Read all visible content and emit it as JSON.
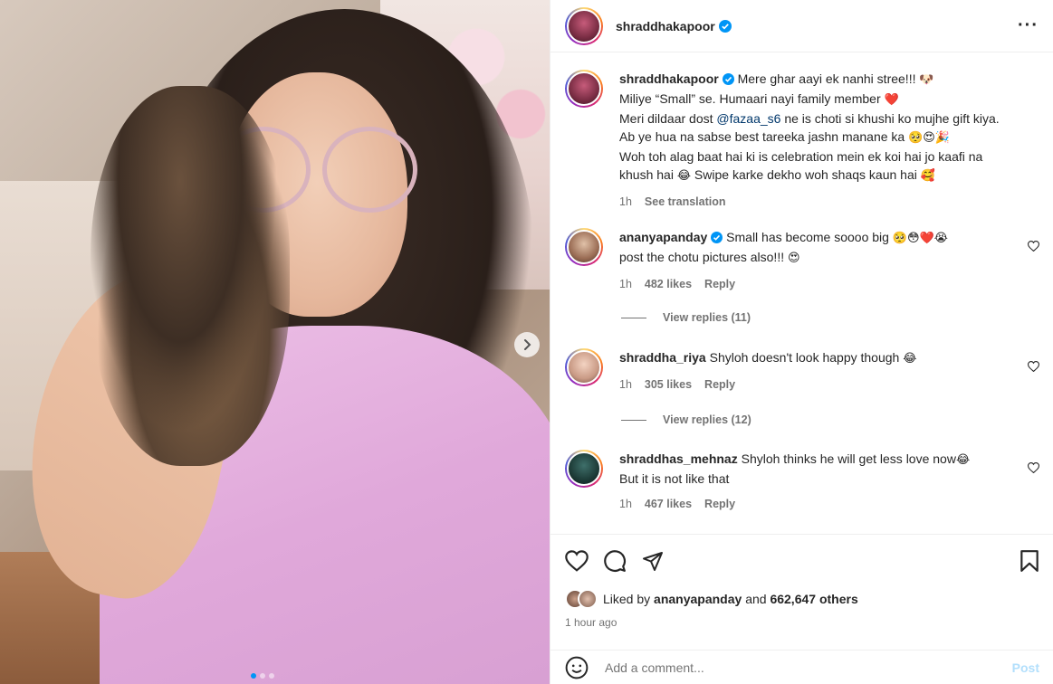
{
  "post": {
    "username": "shraddhakapoor",
    "verified": true,
    "slides": 3,
    "active_slide": 1
  },
  "caption": {
    "username": "shraddhakapoor",
    "part1": " Mere ghar aayi ek nanhi stree!!! ",
    "emoji1": "🐶",
    "line2": "Miliye “Small” se. Humaari nayi family member ",
    "emoji2": "❤️",
    "line3a": "Meri dildaar dost ",
    "mention": "@fazaa_s6",
    "line3b": " ne is choti si khushi ko mujhe gift kiya. Ab ye hua na sabse best tareeka jashn manane ka ",
    "emoji3": "🥺😍🎉",
    "line4": "Woh toh alag baat hai ki is celebration mein ek koi hai jo kaafi na khush hai ",
    "emoji4": "😂",
    "line5": " Swipe karke dekho woh shaqs kaun hai ",
    "emoji5": "🥰",
    "time": "1h",
    "translate": "See translation"
  },
  "comments": [
    {
      "username": "ananyapanday",
      "verified": true,
      "text": " Small has become soooo big ",
      "emoji": "🥺😳❤️😭",
      "text2": "post the chotu pictures also!!! ",
      "emoji2": "😍",
      "time": "1h",
      "likes": "482 likes",
      "reply": "Reply",
      "view_replies": "View replies (11)"
    },
    {
      "username": "shraddha_riya",
      "text": " Shyloh doesn't look happy though ",
      "emoji": "😂",
      "time": "1h",
      "likes": "305 likes",
      "reply": "Reply",
      "view_replies": "View replies (12)"
    },
    {
      "username": "shraddhas_mehnaz",
      "text": " Shyloh thinks he will get less love now",
      "emoji": "😂",
      "text2": "But it is not like that",
      "time": "1h",
      "likes": "467 likes",
      "reply": "Reply"
    }
  ],
  "likes": {
    "prefix": "Liked by ",
    "user": "ananyapanday",
    "middle": " and ",
    "count": "662,647 others"
  },
  "timestamp": "1 hour ago",
  "add_comment": {
    "placeholder": "Add a comment...",
    "post_label": "Post"
  },
  "colors": {
    "accent_blue": "#0095f6",
    "verified_blue": "#0095f6",
    "like_red": "#ed4956",
    "muted": "#737373",
    "post_disabled": "#b2dffc"
  }
}
